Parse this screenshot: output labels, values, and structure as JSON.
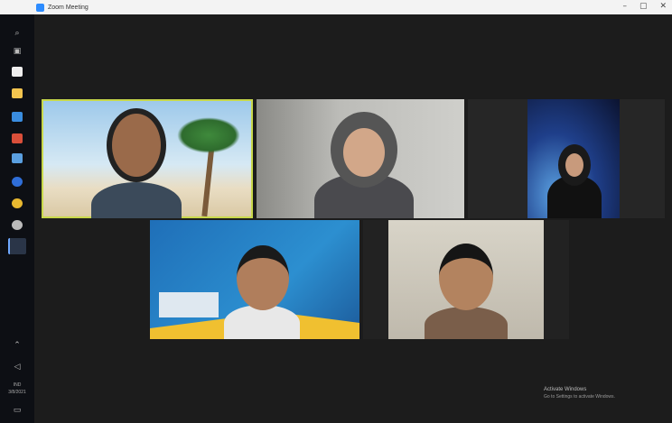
{
  "window": {
    "title": "Zoom Meeting",
    "controls": {
      "minimize": "–",
      "maximize": "▢",
      "close": "✕"
    }
  },
  "taskbar": {
    "icons": [
      "windows-start-icon",
      "search-icon",
      "task-view-icon",
      "file-explorer-icon",
      "folder-icon",
      "mail-icon",
      "office-icon",
      "store-icon",
      "edge-icon",
      "chrome-icon",
      "camera-icon",
      "zoom-icon"
    ],
    "bottom_text_1": "IND",
    "bottom_text_2": "3/8/2021"
  },
  "participants": [
    {
      "id": "p1",
      "label": "",
      "active": true
    },
    {
      "id": "p2",
      "label": "",
      "active": false
    },
    {
      "id": "p3",
      "label": "",
      "active": false
    },
    {
      "id": "p4",
      "label": "",
      "active": false
    },
    {
      "id": "p5",
      "label": "",
      "active": false
    }
  ],
  "watermark": {
    "line1": "Activate Windows",
    "line2": "Go to Settings to activate Windows."
  }
}
